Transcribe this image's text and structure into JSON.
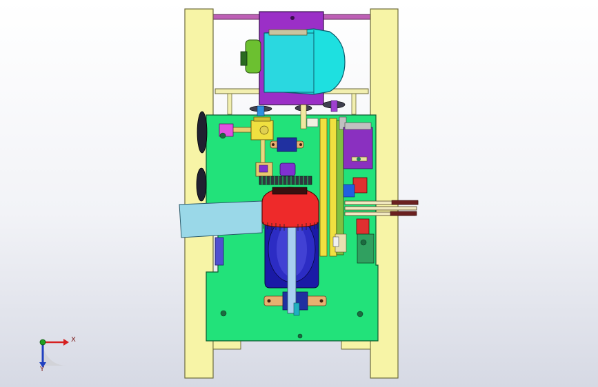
{
  "viewport": {
    "background_top": "#ffffff",
    "background_bottom": "#d6d9e4"
  },
  "triad": {
    "x_label": "X",
    "y_label": "Y",
    "x_color": "#d62020",
    "y_color": "#2040c0",
    "origin_color": "#20a020"
  },
  "colors": {
    "frame": "#f7f4a6",
    "frame_edge": "#6c6a3a",
    "plate": "#22e27a",
    "motor": "#1ee0e0",
    "motor_mount": "#9b2fc7",
    "drum": "#ee2a2a",
    "rod": "#bd5fb5",
    "guide": "#9ad8e8",
    "wheel": "#1a1aa6"
  }
}
